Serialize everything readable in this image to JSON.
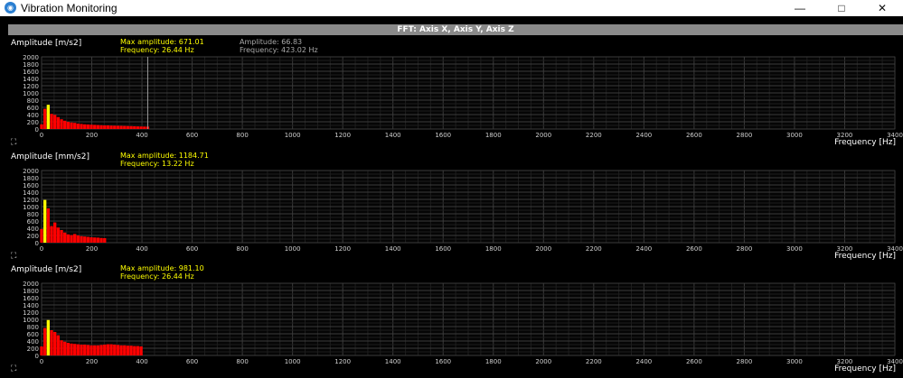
{
  "window": {
    "title": "Vibration Monitoring",
    "icon": "app-icon",
    "controls": [
      "—",
      "□",
      "✕"
    ]
  },
  "header": {
    "title": "FFT: Axis X, Axis Y, Axis Z"
  },
  "panels": [
    {
      "id": "x",
      "ylabel": "Amplitude [m/s2]",
      "xlabel": "Frequency [Hz]",
      "max_amplitude_text": "Max amplitude: 671.01",
      "max_frequency_text": "Frequency: 26.44 Hz",
      "cursor_amplitude_text": "Amplitude: 66.83",
      "cursor_frequency_text": "Frequency: 423.02 Hz",
      "cursor_x": 423.02
    },
    {
      "id": "y",
      "ylabel": "Amplitude [mm/s2]",
      "xlabel": "Frequency [Hz]",
      "max_amplitude_text": "Max amplitude: 1184.71",
      "max_frequency_text": "Frequency: 13.22 Hz"
    },
    {
      "id": "z",
      "ylabel": "Amplitude [m/s2]",
      "xlabel": "Frequency [Hz]",
      "max_amplitude_text": "Max amplitude: 981.10",
      "max_frequency_text": "Frequency: 26.44 Hz"
    }
  ],
  "chart_data": [
    {
      "type": "bar",
      "title": "",
      "xlabel": "Frequency [Hz]",
      "ylabel": "Amplitude [m/s2]",
      "xlim": [
        0,
        3400
      ],
      "ylim": [
        0,
        2000
      ],
      "xticks": [
        0,
        200,
        400,
        600,
        800,
        1000,
        1200,
        1400,
        1600,
        1800,
        2000,
        2200,
        2400,
        2600,
        2800,
        3000,
        3200,
        3400
      ],
      "yticks": [
        0,
        200,
        400,
        600,
        800,
        1000,
        1200,
        1400,
        1600,
        1800,
        2000
      ],
      "grid": true,
      "bar_color": "#ff0000",
      "highlight_color": "#ffff00",
      "highlight_index": 2,
      "x": [
        0,
        13.22,
        26.44,
        39.66,
        52.88,
        66.1,
        79.32,
        92.54,
        105.76,
        118.98,
        132.2,
        145.42,
        158.64,
        171.86,
        185.08,
        198.3,
        211.52,
        224.74,
        237.96,
        251.18,
        264.4,
        277.62,
        290.84,
        304.06,
        317.28,
        330.5,
        343.72,
        356.94,
        370.16,
        383.38,
        396.6,
        409.82,
        423.02
      ],
      "values": [
        130,
        560,
        671,
        420,
        390,
        330,
        270,
        230,
        200,
        180,
        170,
        150,
        140,
        130,
        125,
        120,
        115,
        110,
        105,
        100,
        100,
        95,
        92,
        90,
        88,
        85,
        82,
        80,
        76,
        72,
        70,
        68,
        66.83
      ]
    },
    {
      "type": "bar",
      "title": "",
      "xlabel": "Frequency [Hz]",
      "ylabel": "Amplitude [mm/s2]",
      "xlim": [
        0,
        3400
      ],
      "ylim": [
        0,
        2000
      ],
      "xticks": [
        0,
        200,
        400,
        600,
        800,
        1000,
        1200,
        1400,
        1600,
        1800,
        2000,
        2200,
        2400,
        2600,
        2800,
        3000,
        3200,
        3400
      ],
      "yticks": [
        0,
        200,
        400,
        600,
        800,
        1000,
        1200,
        1400,
        1600,
        1800,
        2000
      ],
      "grid": true,
      "bar_color": "#ff0000",
      "highlight_color": "#ffff00",
      "highlight_index": 1,
      "x": [
        0,
        13.22,
        26.44,
        39.66,
        52.88,
        66.1,
        79.32,
        92.54,
        105.76,
        118.98,
        132.2,
        145.42,
        158.64,
        171.86,
        185.08,
        198.3,
        211.52,
        224.74,
        237.96,
        251.18
      ],
      "values": [
        380,
        1184.71,
        950,
        460,
        560,
        420,
        350,
        280,
        230,
        210,
        240,
        200,
        180,
        170,
        160,
        150,
        145,
        140,
        130,
        125
      ]
    },
    {
      "type": "bar",
      "title": "",
      "xlabel": "Frequency [Hz]",
      "ylabel": "Amplitude [m/s2]",
      "xlim": [
        0,
        3400
      ],
      "ylim": [
        0,
        2000
      ],
      "xticks": [
        0,
        200,
        400,
        600,
        800,
        1000,
        1200,
        1400,
        1600,
        1800,
        2000,
        2200,
        2400,
        2600,
        2800,
        3000,
        3200,
        3400
      ],
      "yticks": [
        0,
        200,
        400,
        600,
        800,
        1000,
        1200,
        1400,
        1600,
        1800,
        2000
      ],
      "grid": true,
      "bar_color": "#ff0000",
      "highlight_color": "#ffff00",
      "highlight_index": 2,
      "x": [
        0,
        13.22,
        26.44,
        39.66,
        52.88,
        66.1,
        79.32,
        92.54,
        105.76,
        118.98,
        132.2,
        145.42,
        158.64,
        171.86,
        185.08,
        198.3,
        211.52,
        224.74,
        237.96,
        251.18,
        264.4,
        277.62,
        290.84,
        304.06,
        317.28,
        330.5,
        343.72,
        356.94,
        370.16,
        383.38,
        396.6
      ],
      "values": [
        250,
        760,
        981.1,
        700,
        650,
        560,
        420,
        380,
        350,
        330,
        320,
        310,
        300,
        300,
        290,
        280,
        280,
        280,
        290,
        300,
        310,
        310,
        300,
        290,
        280,
        280,
        270,
        270,
        260,
        260,
        250
      ]
    }
  ]
}
